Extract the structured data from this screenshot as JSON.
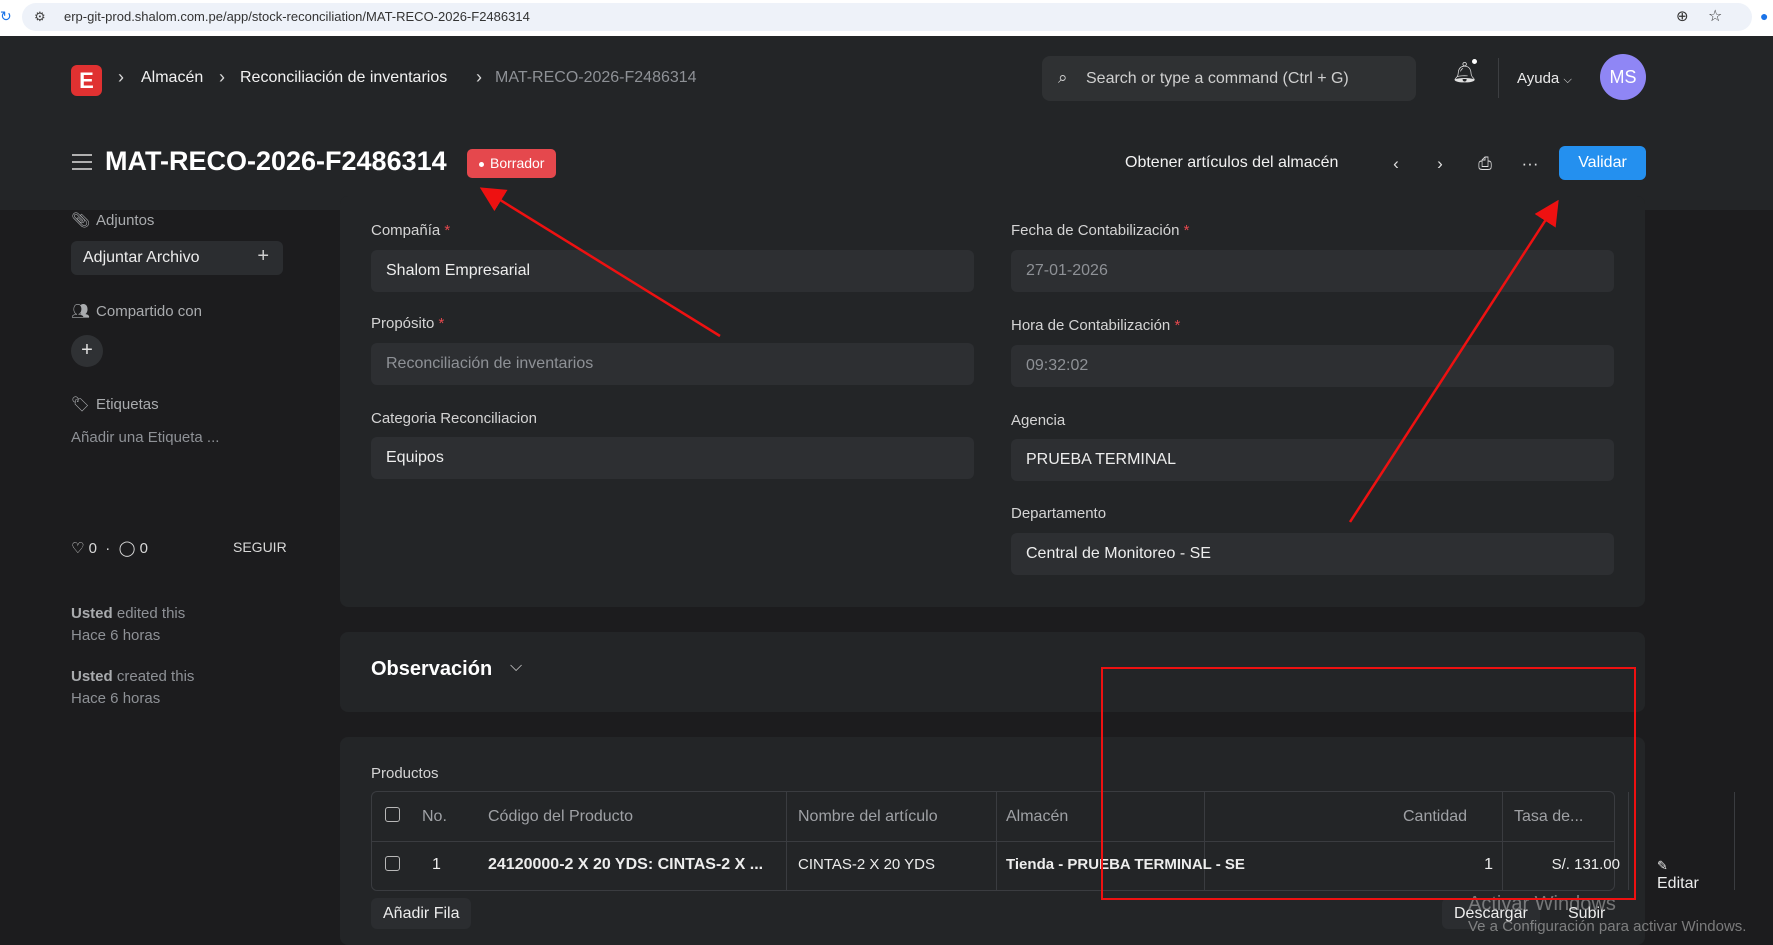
{
  "browser": {
    "url": "erp-git-prod.shalom.com.pe/app/stock-reconciliation/MAT-RECO-2026-F2486314"
  },
  "navbar": {
    "logo": "E",
    "breadcrumbs": [
      "Almacén",
      "Reconciliación de inventarios",
      "MAT-RECO-2026-F2486314"
    ],
    "search_placeholder": "Search or type a command (Ctrl + G)",
    "help": "Ayuda",
    "avatar": "MS"
  },
  "header": {
    "title": "MAT-RECO-2026-F2486314",
    "status": "Borrador",
    "get_items": "Obtener artículos del almacén",
    "submit": "Validar"
  },
  "sidebar": {
    "attachments": "Adjuntos",
    "attach_file": "Adjuntar Archivo",
    "shared_with": "Compartido con",
    "tags": "Etiquetas",
    "add_tag": "Añadir una Etiqueta ...",
    "likes": "0",
    "comments": "0",
    "follow": "SEGUIR",
    "activity": [
      {
        "user": "Usted",
        "action": "edited this",
        "time": "Hace 6 horas"
      },
      {
        "user": "Usted",
        "action": "created this",
        "time": "Hace 6 horas"
      }
    ]
  },
  "form": {
    "company_label": "Compañía",
    "company": "Shalom Empresarial",
    "purpose_label": "Propósito",
    "purpose": "Reconciliación de inventarios",
    "category_label": "Categoria Reconciliacion",
    "category": "Equipos",
    "posting_date_label": "Fecha de Contabilización",
    "posting_date": "27-01-2026",
    "posting_time_label": "Hora de Contabilización",
    "posting_time": "09:32:02",
    "agency_label": "Agencia",
    "agency": "PRUEBA TERMINAL",
    "department_label": "Departamento",
    "department": "Central de Monitoreo - SE"
  },
  "observation": {
    "title": "Observación"
  },
  "products": {
    "label": "Productos",
    "columns": [
      "No.",
      "Código del Producto",
      "Nombre del artículo",
      "Almacén",
      "Cantidad",
      "Tasa de..."
    ],
    "rows": [
      {
        "no": "1",
        "code": "24120000-2 X 20 YDS: CINTAS-2 X ...",
        "name": "CINTAS-2 X 20 YDS",
        "warehouse": "Tienda - PRUEBA TERMINAL - SE",
        "qty": "1",
        "rate": "S/. 131.00",
        "edit": "Editar"
      }
    ],
    "add_row": "Añadir Fila",
    "download": "Descargar",
    "upload": "Subir"
  },
  "os_watermark": {
    "line1": "Activar Windows",
    "line2": "Ve a Configuración para activar Windows."
  }
}
